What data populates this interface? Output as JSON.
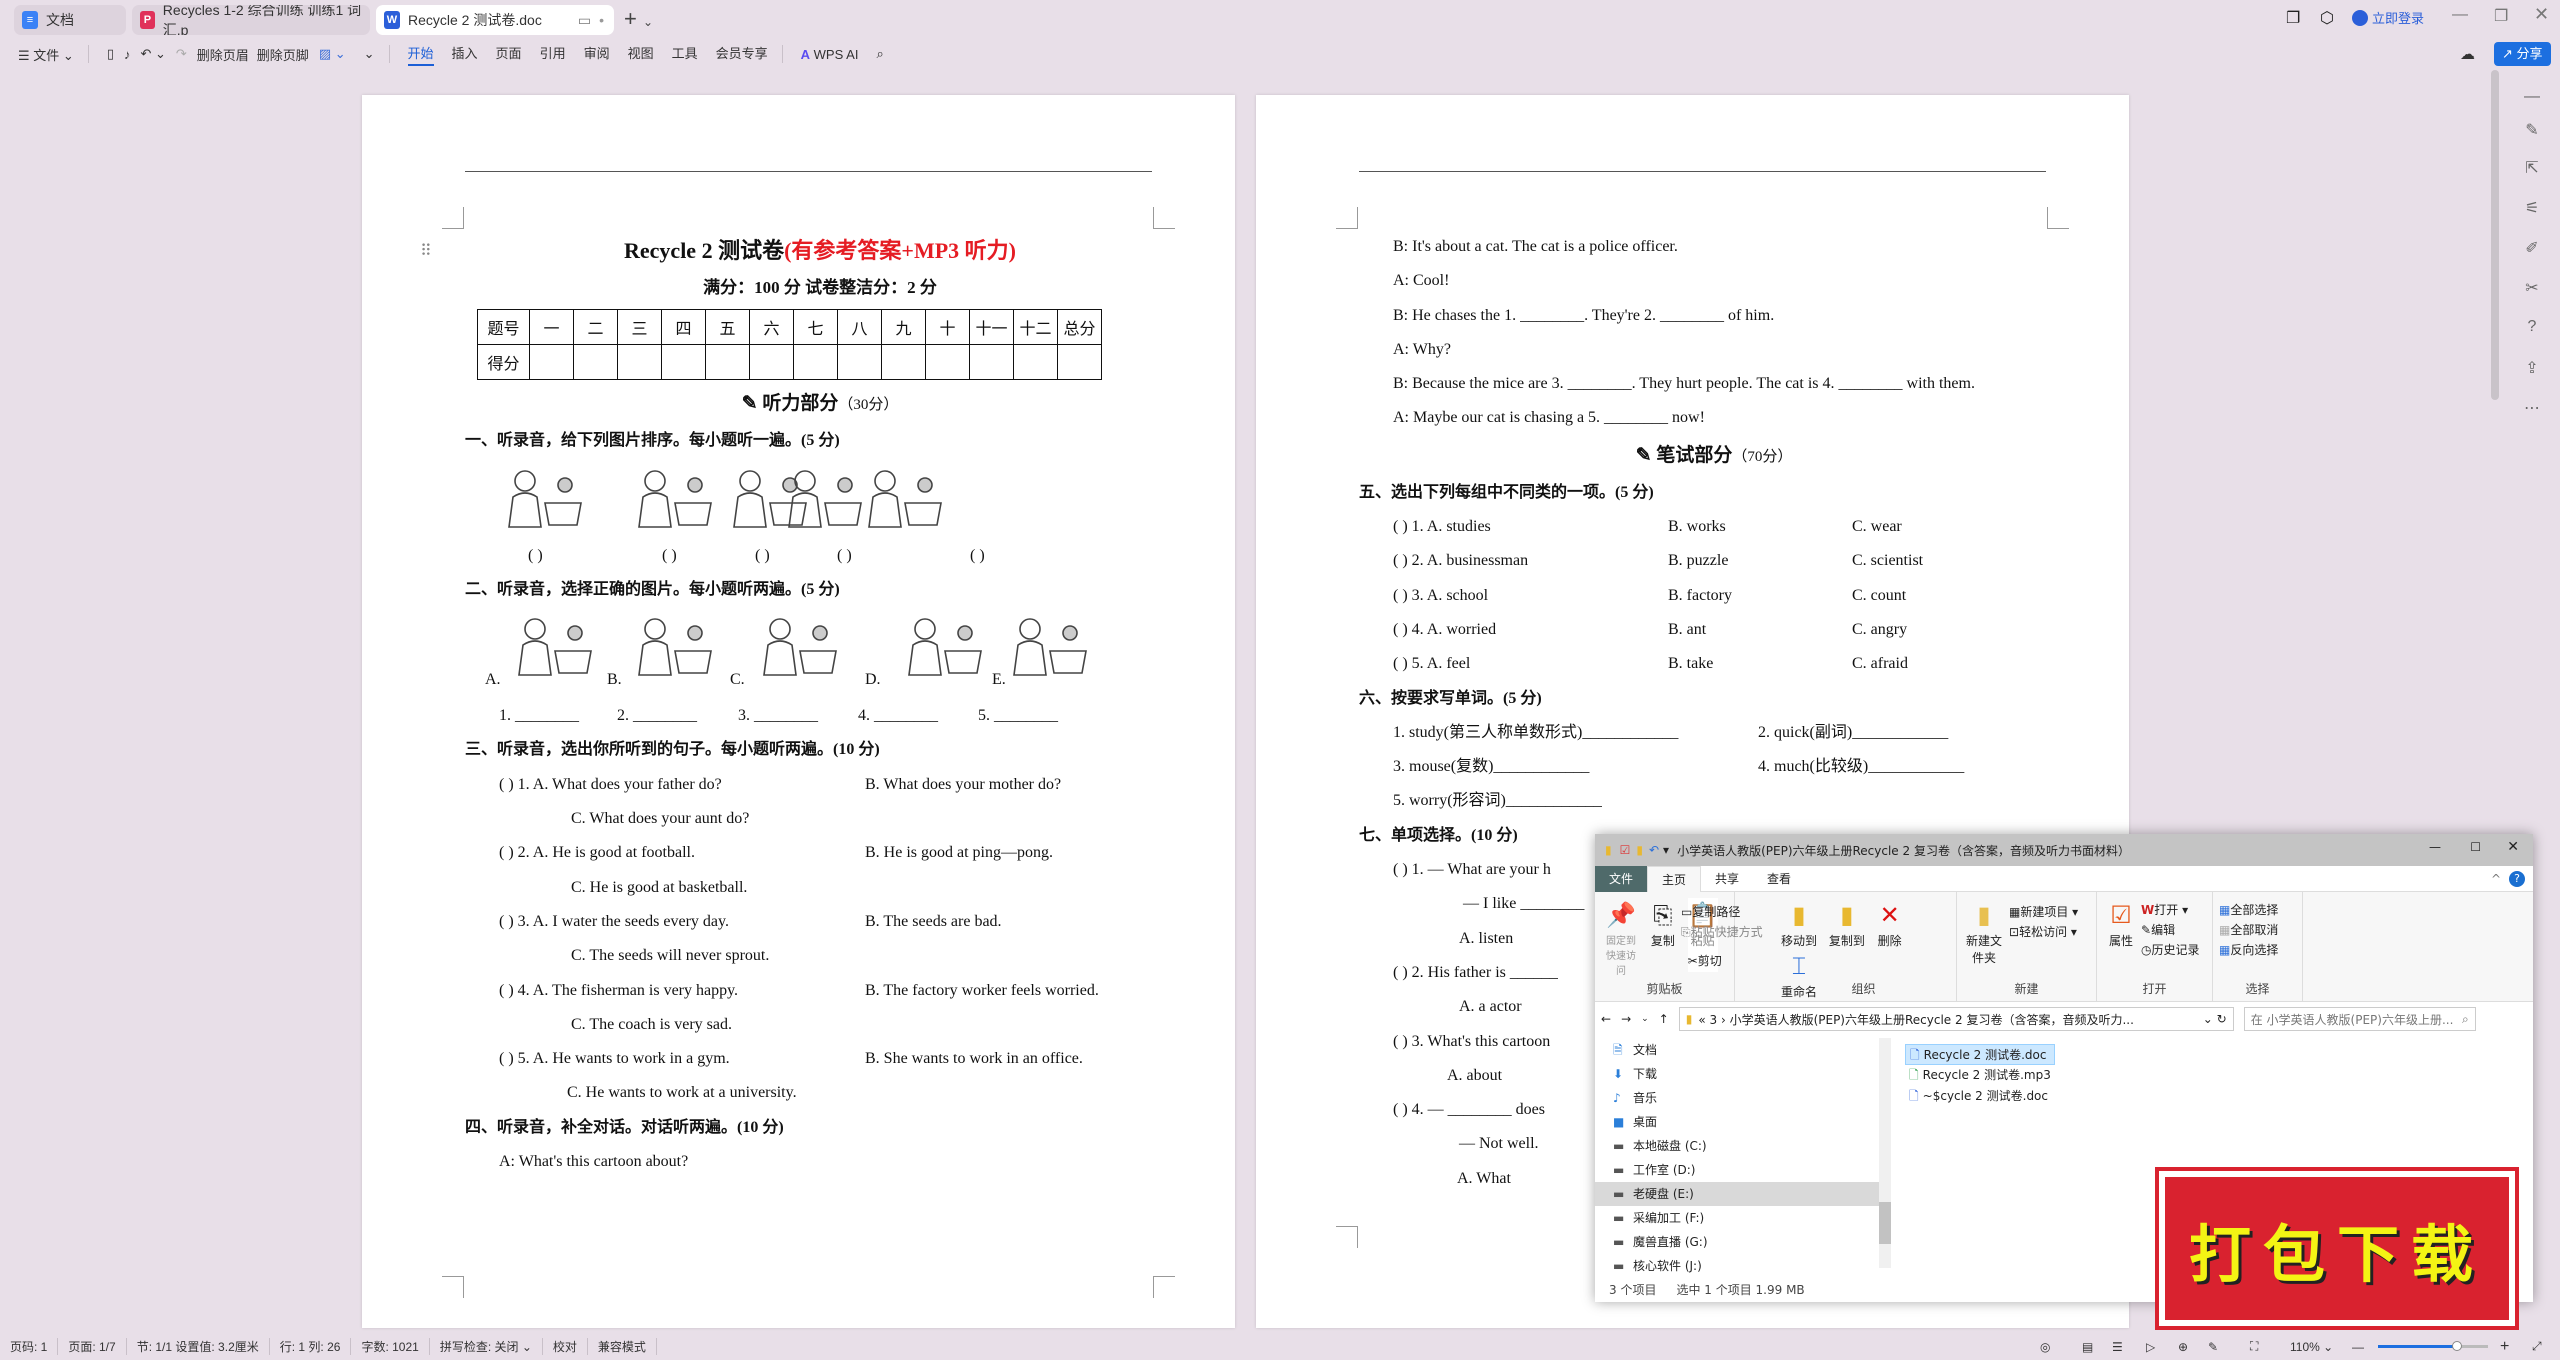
{
  "tabs": [
    {
      "label": "文档",
      "icon": "doc-icon",
      "color": "#3b82f6"
    },
    {
      "label": "Recycles 1-2 综合训练 训练1 词汇.p",
      "icon": "pdf-icon",
      "color": "#e0315a"
    },
    {
      "label": "Recycle 2 测试卷.doc",
      "icon": "word-icon",
      "color": "#2b5fd9",
      "active": true
    }
  ],
  "toolbar": {
    "file": "文件",
    "delete_header": "删除页眉",
    "delete_footer": "删除页脚",
    "menus": [
      "开始",
      "插入",
      "页面",
      "引用",
      "审阅",
      "视图",
      "工具",
      "会员专享"
    ],
    "active_menu": "开始",
    "wps_ai": "WPS AI"
  },
  "window": {
    "login": "立即登录",
    "share": "分享",
    "accent": "#1c6fe0"
  },
  "left_page": {
    "title_black": "Recycle 2 测试卷",
    "title_red": "(有参考答案+MP3 听力)",
    "subtitle": "满分：100 分    试卷整洁分：2 分",
    "table_header": [
      "题号",
      "一",
      "二",
      "三",
      "四",
      "五",
      "六",
      "七",
      "八",
      "九",
      "十",
      "十一",
      "十二",
      "总分"
    ],
    "table_row_label": "得分",
    "listening_band": "听力部分",
    "listening_points": "（30分）",
    "sec1": "一、听录音，给下列图片排序。每小题听一遍。(5 分)",
    "sec1_blanks": [
      "(      )",
      "(      )",
      "(      )",
      "(      )",
      "(      )"
    ],
    "sec2": "二、听录音，选择正确的图片。每小题听两遍。(5 分)",
    "sec2_labels": [
      "A.",
      "B.",
      "C.",
      "D.",
      "E."
    ],
    "sec2_blanks": [
      "1. ________",
      "2. ________",
      "3. ________",
      "4. ________",
      "5. ________"
    ],
    "sec3": "三、听录音，选出你所听到的句子。每小题听两遍。(10 分)",
    "sec3_items": [
      {
        "a": "(      ) 1. A. What does your father do?",
        "b": "B. What does your mother do?",
        "c": "C. What does your aunt do?"
      },
      {
        "a": "(      ) 2. A. He is good at football.",
        "b": "B. He is good at ping—pong.",
        "c": "C. He is good at basketball."
      },
      {
        "a": "(      ) 3. A. I water the seeds every day.",
        "b": "B. The seeds are bad.",
        "c": "C. The seeds will never sprout."
      },
      {
        "a": "(      ) 4. A. The fisherman is very happy.",
        "b": "B. The factory worker feels worried.",
        "c": "C. The coach is very sad."
      },
      {
        "a": "(      ) 5. A. He wants to work in a gym.",
        "b": "B. She wants to work in an office.",
        "c": "C. He wants to work at a university."
      }
    ],
    "sec4": "四、听录音，补全对话。对话听两遍。(10 分)",
    "sec4_first": "A: What's this cartoon about?"
  },
  "right_page": {
    "dialog": [
      "B: It's about a cat. The cat is a police officer.",
      "A: Cool!",
      "B: He chases the 1. ________. They're 2. ________ of him.",
      "A: Why?",
      "B: Because the mice are 3. ________. They hurt people. The cat is 4. ________ with them.",
      "A: Maybe our cat is chasing a 5. ________ now!"
    ],
    "writing_band": "笔试部分",
    "writing_points": "（70分）",
    "sec5": "五、选出下列每组中不同类的一项。(5 分)",
    "sec5_items": [
      [
        "(      ) 1. A. studies",
        "B. works",
        "C. wear"
      ],
      [
        "(      ) 2. A. businessman",
        "B. puzzle",
        "C. scientist"
      ],
      [
        "(      ) 3. A. school",
        "B. factory",
        "C. count"
      ],
      [
        "(      ) 4. A. worried",
        "B. ant",
        "C. angry"
      ],
      [
        "(      ) 5. A. feel",
        "B. take",
        "C. afraid"
      ]
    ],
    "sec6": "六、按要求写单词。(5 分)",
    "sec6_items": [
      [
        "1. study(第三人称单数形式)____________",
        "2. quick(副词)____________"
      ],
      [
        "3. mouse(复数)____________",
        "4. much(比较级)____________"
      ],
      [
        "5. worry(形容词)____________",
        ""
      ]
    ],
    "sec7": "七、单项选择。(10 分)",
    "sec7_lines": [
      "(      ) 1. — What are your h",
      "— I like ________",
      "A. listen",
      "(      ) 2. His father is ______",
      "A. a actor",
      "(      ) 3. What's this cartoon",
      "A. about",
      "(      ) 4. — ________ does",
      "— Not well.",
      "A. What"
    ]
  },
  "explorer": {
    "title": "小学英语人教版(PEP)六年级上册Recycle 2 复习卷（含答案，音频及听力书面材料）",
    "tabs": [
      "文件",
      "主页",
      "共享",
      "查看"
    ],
    "ribbon": {
      "clipboard": {
        "label": "剪贴板",
        "pin": "固定到快速访问",
        "copy": "复制",
        "paste": "粘贴",
        "copy_path": "复制路径",
        "paste_shortcut": "粘贴快捷方式",
        "cut": "剪切"
      },
      "organize": {
        "label": "组织",
        "move_to": "移动到",
        "copy_to": "复制到",
        "delete": "删除",
        "rename": "重命名"
      },
      "new": {
        "label": "新建",
        "new_folder": "新建文件夹",
        "new_item": "新建项目",
        "easy_access": "轻松访问"
      },
      "open": {
        "label": "打开",
        "properties": "属性",
        "open": "打开",
        "edit": "编辑",
        "history": "历史记录"
      },
      "select": {
        "label": "选择",
        "select_all": "全部选择",
        "select_none": "全部取消",
        "invert": "反向选择"
      }
    },
    "address": "«  3  ›  小学英语人教版(PEP)六年级上册Recycle 2 复习卷（含答案，音频及听力...",
    "search_placeholder": "在 小学英语人教版(PEP)六年级上册...",
    "nav": [
      {
        "label": "文档",
        "icon": "document-icon"
      },
      {
        "label": "下载",
        "icon": "download-icon"
      },
      {
        "label": "音乐",
        "icon": "music-icon"
      },
      {
        "label": "桌面",
        "icon": "desktop-icon"
      },
      {
        "label": "本地磁盘 (C:)",
        "icon": "drive-icon"
      },
      {
        "label": "工作室 (D:)",
        "icon": "drive-icon"
      },
      {
        "label": "老硬盘 (E:)",
        "icon": "drive-icon",
        "selected": true
      },
      {
        "label": "采编加工 (F:)",
        "icon": "drive-icon"
      },
      {
        "label": "魔兽直播 (G:)",
        "icon": "drive-icon"
      },
      {
        "label": "核心软件 (J:)",
        "icon": "drive-icon"
      }
    ],
    "files": [
      {
        "name": "Recycle 2 测试卷.doc",
        "selected": true
      },
      {
        "name": "Recycle 2 测试卷.mp3"
      },
      {
        "name": "~$cycle 2 测试卷.doc"
      }
    ],
    "status_count": "3 个项目",
    "status_selected": "选中 1 个项目  1.99 MB"
  },
  "stamp": "打包下载",
  "statusbar": {
    "items": [
      "页码: 1",
      "页面: 1/7",
      "节: 1/1  设置值: 3.2厘米",
      "行: 1   列: 26",
      "字数: 1021",
      "拼写检查: 关闭 ⌄",
      "校对",
      "兼容模式"
    ],
    "zoom": "110%",
    "zoom_level": 110
  }
}
